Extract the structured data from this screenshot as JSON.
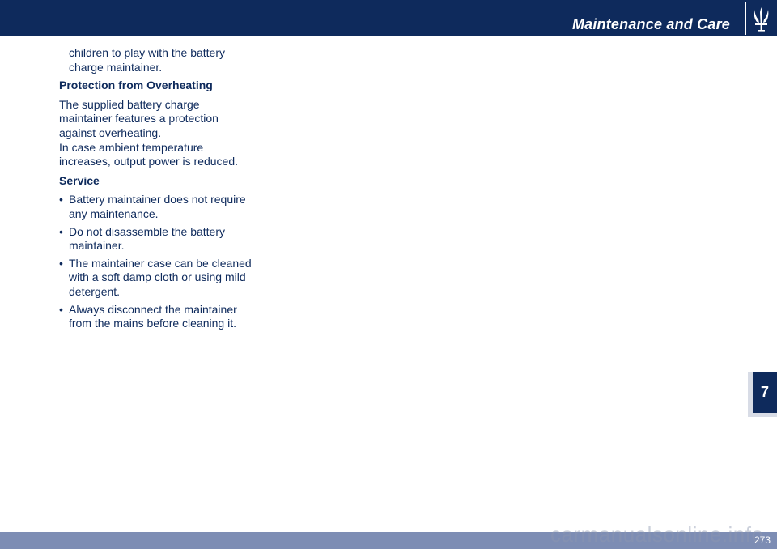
{
  "header": {
    "section_title": "Maintenance and Care",
    "logo_icon": "maserati-trident-icon"
  },
  "body": {
    "intro_lines": [
      "children to play with the battery",
      "charge maintainer."
    ],
    "overheating": {
      "heading": "Protection from Overheating",
      "lines": [
        "The supplied battery charge",
        "maintainer features a protection",
        "against overheating.",
        "In case ambient temperature",
        "increases, output power is reduced."
      ]
    },
    "service": {
      "heading": "Service",
      "bullet_symbol": "•",
      "items": [
        [
          "Battery maintainer does not require",
          "any maintenance."
        ],
        [
          "Do not disassemble the battery",
          "maintainer."
        ],
        [
          "The maintainer case can be cleaned",
          "with a soft damp cloth or using mild",
          "detergent."
        ],
        [
          "Always disconnect the maintainer",
          "from the mains before cleaning it."
        ]
      ]
    }
  },
  "chapter_tab": {
    "number": "7"
  },
  "footer": {
    "page_number": "273",
    "watermark": "carmanualsonline.info"
  },
  "colors": {
    "navy": "#0e2a5c",
    "footer_bar": "#7d8db4",
    "text": "#0e2a5c"
  }
}
